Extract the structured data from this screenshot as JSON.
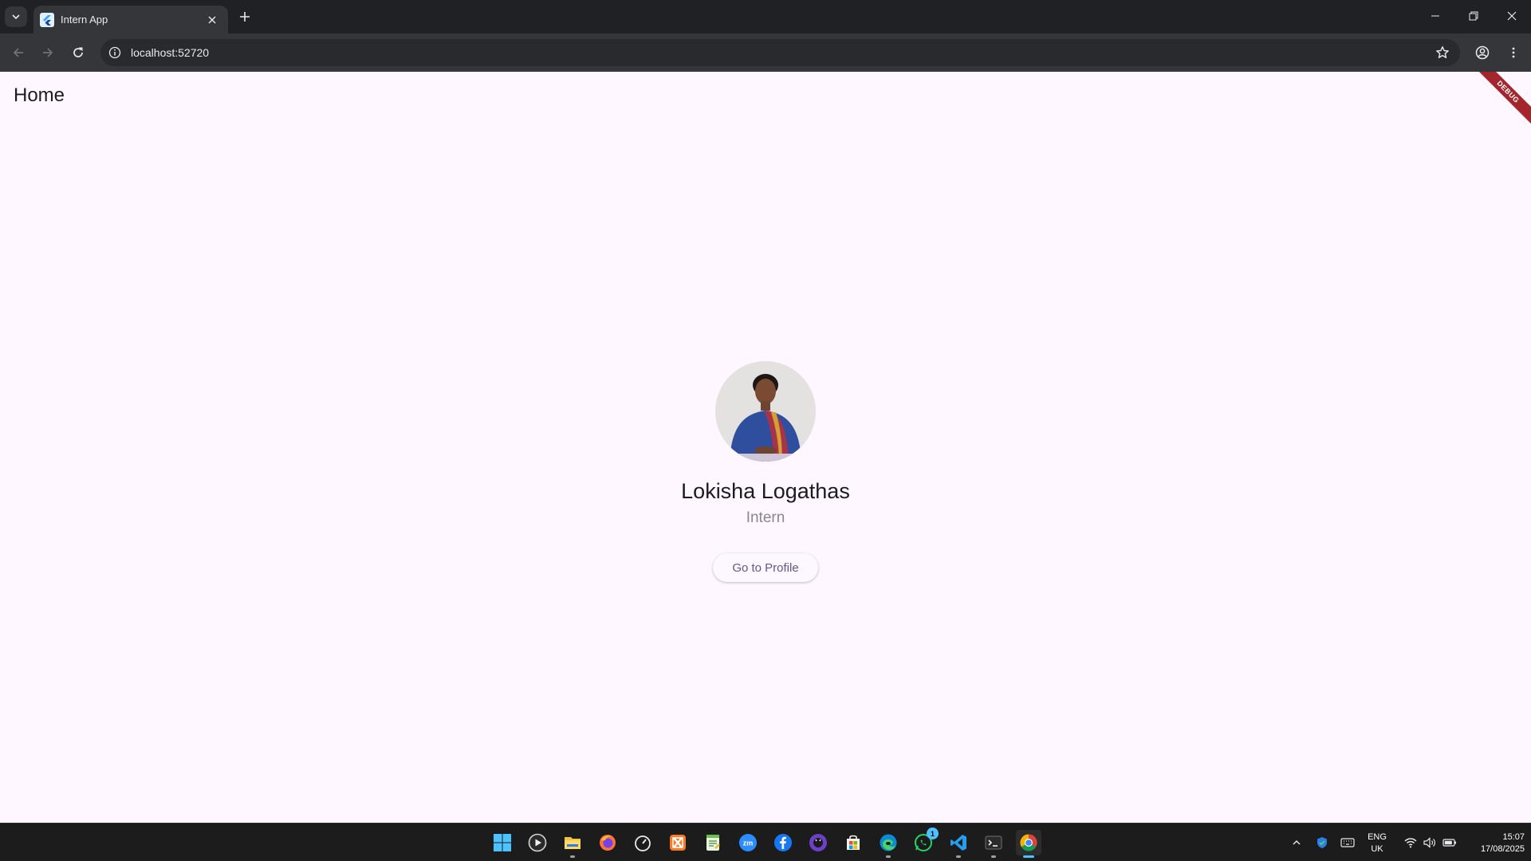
{
  "browser": {
    "tab_title": "Intern App",
    "url": "localhost:52720"
  },
  "app": {
    "appbar_title": "Home",
    "debug_banner": "DEBUG",
    "profile": {
      "name": "Lokisha Logathas",
      "role": "Intern",
      "button_label": "Go to Profile"
    }
  },
  "taskbar": {
    "apps": [
      "start-icon",
      "media-player-icon",
      "file-explorer-icon",
      "firefox-icon",
      "speedometer-icon",
      "xampp-icon",
      "notepad-icon",
      "zoom-icon",
      "facebook-icon",
      "github-icon",
      "store-icon",
      "edge-icon",
      "whatsapp-icon",
      "vscode-icon",
      "terminal-icon",
      "chrome-icon"
    ],
    "whatsapp_badge": "1",
    "language": "ENG",
    "region": "UK",
    "time": "15:07",
    "date": "17/08/2025"
  },
  "colors": {
    "page_bg": "#fef7ff",
    "button_text": "#65558f",
    "debug_banner": "#a3262d",
    "chrome_dark": "#202124"
  }
}
